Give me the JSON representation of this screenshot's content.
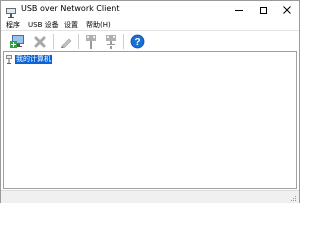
{
  "window": {
    "title": "USB over Network Client",
    "icons": {
      "app": "usb-plug-icon",
      "minimize": "minimize-icon",
      "maximize": "maximize-icon",
      "close": "close-icon"
    }
  },
  "menu": {
    "items": [
      {
        "label": "程序"
      },
      {
        "label": "USB 设备"
      },
      {
        "label": "设置"
      },
      {
        "label": "帮助(H)"
      }
    ]
  },
  "toolbar": {
    "buttons": [
      {
        "icon": "add-server-icon",
        "enabled": true
      },
      {
        "icon": "remove-icon",
        "enabled": false
      },
      {
        "icon": "edit-icon",
        "enabled": false
      },
      {
        "icon": "connect-usb-icon",
        "enabled": false
      },
      {
        "icon": "disconnect-usb-icon",
        "enabled": false
      },
      {
        "icon": "help-icon",
        "enabled": true
      }
    ]
  },
  "tree": {
    "root": {
      "label": "我的计算机",
      "icon": "computer-usb-icon",
      "selected": true
    }
  },
  "colors": {
    "selection": "#0a64d8",
    "help": "#1a6fd6",
    "add_green": "#2aa83a",
    "disabled": "#a8a8a8"
  }
}
